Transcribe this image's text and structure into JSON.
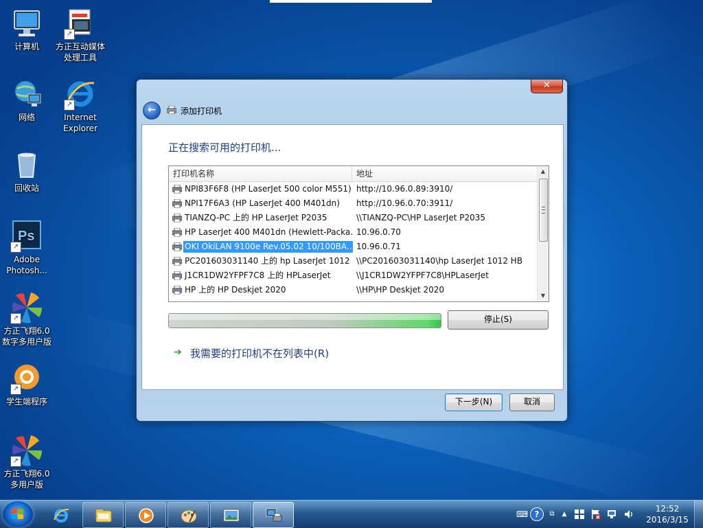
{
  "desktop": {
    "icons": [
      {
        "label": "计算机",
        "icon": "computer-icon"
      },
      {
        "label": "方正互动媒体处理工具",
        "icon": "media-tool-icon"
      },
      {
        "label": "网络",
        "icon": "network-icon"
      },
      {
        "label": "Internet Explorer",
        "icon": "ie-icon"
      },
      {
        "label": "回收站",
        "icon": "recycle-bin-icon"
      },
      {
        "label": "Adobe Photosh...",
        "icon": "photoshop-icon"
      },
      {
        "label": "方正飞翔6.0数字多用户版",
        "icon": "founder-feixiang-icon"
      },
      {
        "label": "学生端程序",
        "icon": "student-client-icon"
      },
      {
        "label": "方正飞翔6.0多用户版",
        "icon": "founder-feixiang-icon"
      }
    ]
  },
  "dialog": {
    "title": "添加打印机",
    "close_label": "✕",
    "heading": "正在搜索可用的打印机...",
    "columns": {
      "name": "打印机名称",
      "address": "地址"
    },
    "printers": [
      {
        "name": "NPI83F6F8 (HP LaserJet 500 color M551)",
        "address": "http://10.96.0.89:3910/"
      },
      {
        "name": "NPI17F6A3 (HP LaserJet 400 M401dn)",
        "address": "http://10.96.0.70:3911/"
      },
      {
        "name": "TIANZQ-PC 上的 HP LaserJet P2035",
        "address": "\\\\TIANZQ-PC\\HP LaserJet P2035"
      },
      {
        "name": "HP LaserJet 400 M401dn (Hewlett-Packa...",
        "address": "10.96.0.70"
      },
      {
        "name": "OKI OkiLAN 9100e Rev.05.02 10/100BA...",
        "address": "10.96.0.71",
        "selected": true
      },
      {
        "name": "PC201603031140 上的 hp LaserJet 1012 ...",
        "address": "\\\\PC201603031140\\hp LaserJet 1012 HB"
      },
      {
        "name": "J1CR1DW2YFPF7C8 上的 HPLaserJet",
        "address": "\\\\J1CR1DW2YFPF7C8\\HPLaserJet"
      },
      {
        "name": "HP 上的 HP Deskjet 2020",
        "address": "\\\\HP\\HP Deskjet 2020"
      }
    ],
    "progress": 1.0,
    "stop_label": "停止(S)",
    "not_listed_link": "我需要的打印机不在列表中(R)",
    "next_label": "下一步(N)",
    "cancel_label": "取消"
  },
  "taskbar": {
    "pinned": [
      "ie-icon",
      "explorer-folder-icon",
      "media-player-icon",
      "paint-icon",
      "photo-viewer-icon",
      "devices-printers-icon"
    ],
    "tray": [
      "keyboard-icon",
      "help-icon",
      "network-icon",
      "show-hidden-icon",
      "action-center-icon",
      "flag-error-icon",
      "network-status-icon",
      "volume-icon"
    ],
    "time": "12:52",
    "date": "2016/3/15"
  }
}
